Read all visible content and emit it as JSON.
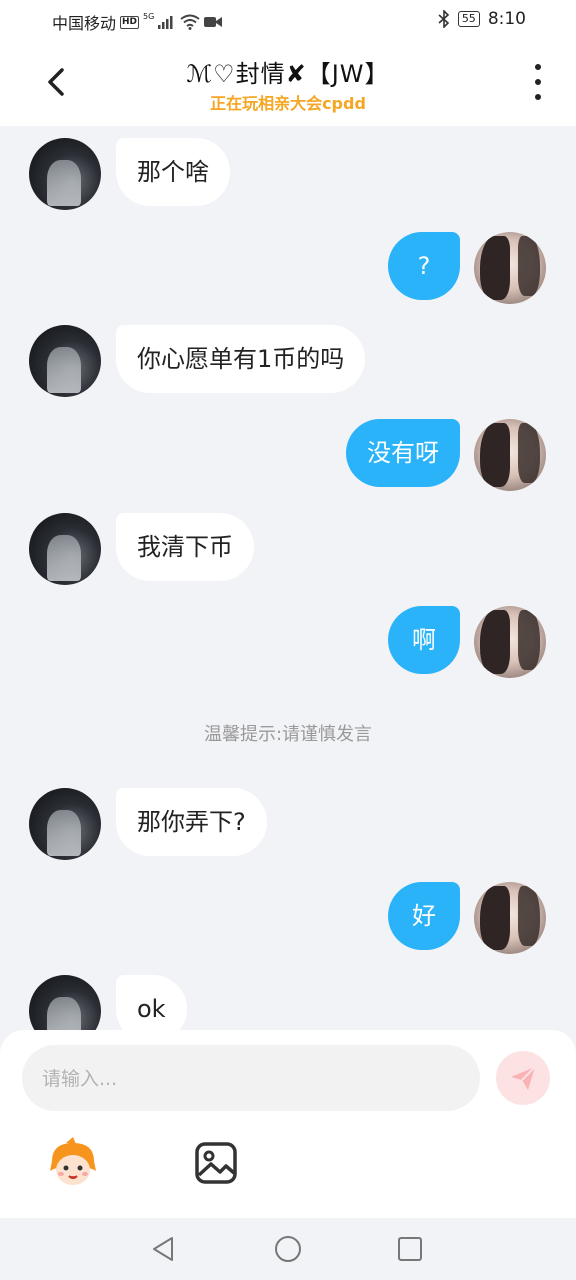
{
  "status_bar": {
    "carrier": "中国移动",
    "hd": "HD",
    "network": "5G",
    "battery": "55",
    "time": "8:10"
  },
  "header": {
    "title": "ℳ♡封情✘【JW】",
    "subtitle": "正在玩相亲大会cpdd"
  },
  "messages": [
    {
      "side": "other",
      "text": "那个啥"
    },
    {
      "side": "self",
      "text": "?"
    },
    {
      "side": "other",
      "text": "你心愿单有1币的吗"
    },
    {
      "side": "self",
      "text": "没有呀"
    },
    {
      "side": "other",
      "text": "我清下币"
    },
    {
      "side": "self",
      "text": "啊"
    },
    {
      "side": "other",
      "text": "那你弄下?"
    },
    {
      "side": "self",
      "text": "好"
    },
    {
      "side": "other",
      "text": "ok"
    }
  ],
  "notice": "温馨提示:请谨慎发言",
  "input": {
    "placeholder": "请输入...",
    "value": ""
  },
  "icons": {
    "back": "chevron-left-icon",
    "more": "more-vertical-icon",
    "send": "send-icon",
    "emoji": "mascot-emoji-icon",
    "image": "image-icon"
  },
  "colors": {
    "self_bubble": "#2bb3f9",
    "other_bubble": "#ffffff",
    "subtitle": "#f5a623",
    "send_button": "#fde2e3"
  }
}
